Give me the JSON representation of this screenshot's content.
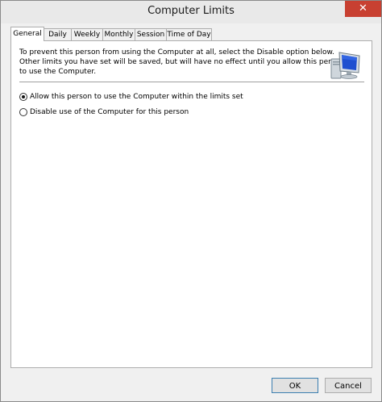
{
  "window": {
    "title": "Computer Limits",
    "close_glyph": "✕"
  },
  "tabs": [
    {
      "label": "General",
      "active": true
    },
    {
      "label": "Daily",
      "active": false
    },
    {
      "label": "Weekly",
      "active": false
    },
    {
      "label": "Monthly",
      "active": false
    },
    {
      "label": "Session",
      "active": false
    },
    {
      "label": "Time of Day",
      "active": false
    }
  ],
  "general": {
    "description_lines": [
      "To prevent this person from using the Computer at all, select the Disable option below.",
      "Other limits you have set will be saved, but will have no effect until you allow this person",
      "to use the Computer."
    ],
    "options": [
      {
        "label": "Allow this person to use the Computer within the limits set",
        "selected": true
      },
      {
        "label": "Disable use of the Computer for this person",
        "selected": false
      }
    ],
    "icon": "computer-monitor-icon"
  },
  "buttons": {
    "ok_label": "OK",
    "cancel_label": "Cancel"
  },
  "colors": {
    "close_button": "#c84031",
    "monitor_screen": "#1f4fd0",
    "ok_border": "#3c7fb1"
  }
}
